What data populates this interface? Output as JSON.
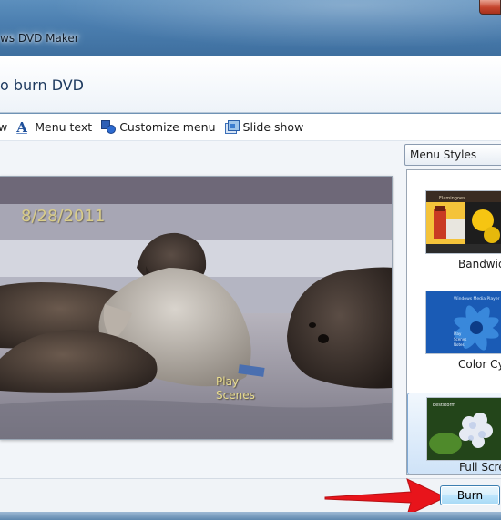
{
  "window": {
    "title": "ws DVD Maker",
    "close_icon": "close-icon"
  },
  "header": {
    "title": "o burn DVD"
  },
  "toolbar": {
    "items": [
      {
        "label": "w",
        "icon": "preview-icon"
      },
      {
        "label": "Menu text",
        "icon": "menu-text-icon"
      },
      {
        "label": "Customize menu",
        "icon": "customize-menu-icon"
      },
      {
        "label": "Slide show",
        "icon": "slide-show-icon"
      }
    ]
  },
  "preview": {
    "date": "8/28/2011",
    "play_line1": "Play",
    "play_line2": "Scenes"
  },
  "styles": {
    "dropdown": "Menu Styles",
    "items": [
      {
        "label": "Bandwidt",
        "selected": false
      },
      {
        "label": "Color Cyc",
        "selected": false
      },
      {
        "label": "Full Scree",
        "selected": true
      }
    ],
    "thumb1_caption": "Flamingoes",
    "thumb2_caption": "Windows Media Player",
    "thumb2_menu": [
      "Play",
      "Scenes",
      "Notes"
    ],
    "thumb3_caption": "beststorm"
  },
  "footer": {
    "burn_label": "Burn",
    "arrow_color": "#e8141b"
  }
}
